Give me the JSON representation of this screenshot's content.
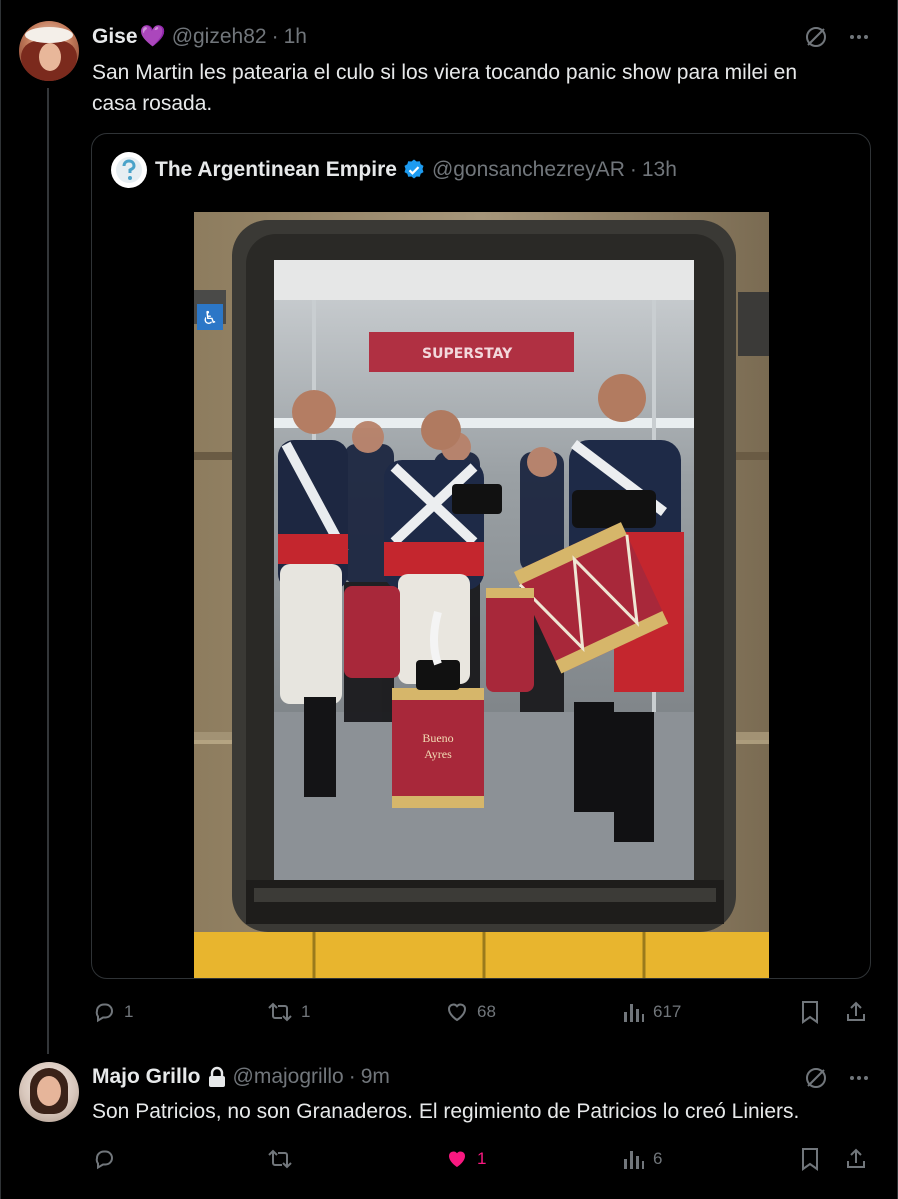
{
  "tweet1": {
    "display_name": "Gise",
    "name_emoji": "💜",
    "handle": "@gizeh82",
    "time": "1h",
    "text_line1": "San Martin les patearia el culo si los viera tocando panic show para milei en",
    "text_line2": "casa rosada.",
    "quote": {
      "display_name": "The Argentinean Empire",
      "verified": true,
      "handle": "@gonsanchezreyAR",
      "time": "13h",
      "photo_sign": "SUPERSTAY",
      "drum_text_1": "Bueno",
      "drum_text_2": "Ayres"
    },
    "actions": {
      "replies": "1",
      "reposts": "1",
      "likes": "68",
      "views": "617"
    }
  },
  "tweet2": {
    "display_name": "Majo Grillo",
    "locked": true,
    "handle": "@majogrillo",
    "time": "9m",
    "text": "Son Patricios, no son Granaderos. El regimiento de Patricios lo creó Liniers.",
    "actions": {
      "replies": "",
      "reposts": "",
      "likes": "1",
      "liked": true,
      "views": "6"
    }
  },
  "separator": "·",
  "colors": {
    "background": "#000000",
    "text": "#e7e9ea",
    "muted": "#71767b",
    "border": "#2f3336",
    "verified": "#1d9bf0",
    "like": "#f91880",
    "heart_emoji": "#a97bd8"
  },
  "icons": [
    "grok-icon",
    "more-icon",
    "reply-icon",
    "repost-icon",
    "like-icon",
    "views-icon",
    "bookmark-icon",
    "share-icon",
    "verified-badge-icon",
    "lock-icon"
  ]
}
